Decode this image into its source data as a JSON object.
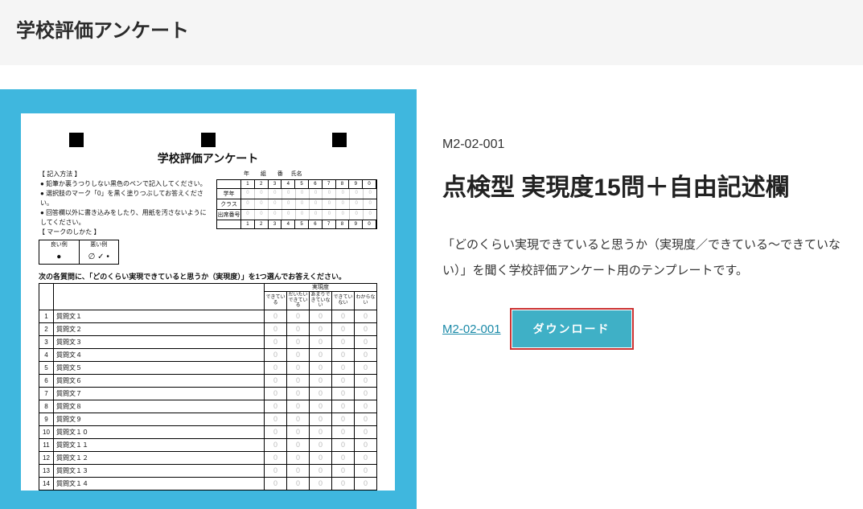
{
  "header": {
    "title": "学校評価アンケート"
  },
  "preview": {
    "title": "学校評価アンケート",
    "instr_head": "【 記入方法 】",
    "instr": [
      "鉛筆か裏うつりしない黒色のペンで記入してください。",
      "選択肢のマーク「0」を黒く塗りつぶしてお答えください。",
      "回答欄以外に書き込みをしたり、用紙を汚さないようにしてください。"
    ],
    "mark_head": "【 マークのしかた 】",
    "mark_good": "良い例",
    "mark_bad": "悪い例",
    "id_labels": {
      "year": "年",
      "term": "組",
      "num": "番",
      "name": "氏名"
    },
    "id_rows": [
      "学年",
      "クラス",
      "出席番号"
    ],
    "nums": [
      "1",
      "2",
      "3",
      "4",
      "5",
      "6",
      "7",
      "8",
      "9",
      "0"
    ],
    "instr_line": "次の各質問に、「どのくらい実現できていると思うか（実現度）」を1つ選んでお答えください。",
    "scale_head": "実現度",
    "scale": [
      "できている",
      "だいたいできている",
      "あまりできていない",
      "できていない",
      "わからない"
    ],
    "questions": [
      "質問文１",
      "質問文２",
      "質問文３",
      "質問文４",
      "質問文５",
      "質問文６",
      "質問文７",
      "質問文８",
      "質問文９",
      "質問文１０",
      "質問文１１",
      "質問文１２",
      "質問文１３",
      "質問文１４"
    ]
  },
  "detail": {
    "code": "M2-02-001",
    "title": "点検型 実現度15問＋自由記述欄",
    "desc": "「どのくらい実現できていると思うか（実現度／できている～できていない）」を聞く学校評価アンケート用のテンプレートです。",
    "link_label": "M2-02-001",
    "button_label": "ダウンロード"
  }
}
